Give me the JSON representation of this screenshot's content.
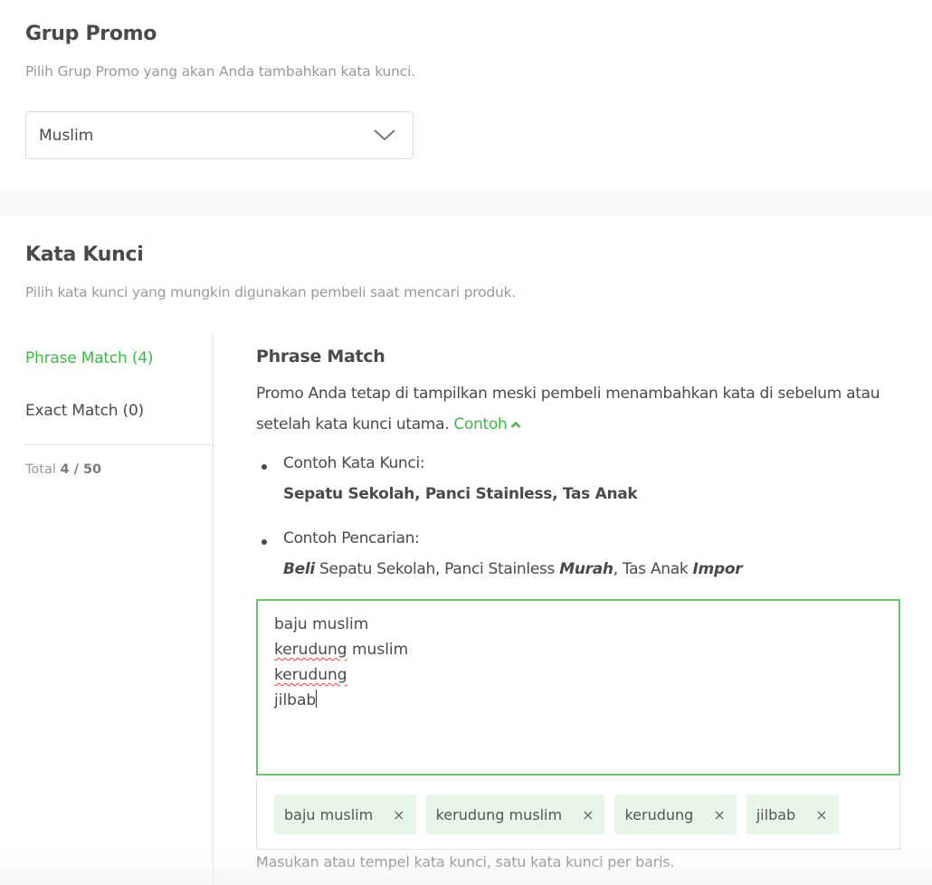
{
  "grup_promo": {
    "title": "Grup Promo",
    "subtitle": "Pilih Grup Promo yang akan Anda tambahkan kata kunci.",
    "select_value": "Muslim",
    "select_icon": "chevron-down-icon"
  },
  "kata_kunci": {
    "title": "Kata Kunci",
    "subtitle": "Pilih kata kunci yang mungkin digunakan pembeli saat mencari produk."
  },
  "sidebar": {
    "items": [
      {
        "label": "Phrase Match (4)",
        "active": true
      },
      {
        "label": "Exact Match (0)",
        "active": false
      }
    ],
    "total_label": "Total",
    "total_value": "4 / 50"
  },
  "phrase_match": {
    "title": "Phrase Match",
    "description": "Promo Anda tetap di tampilkan meski pembeli menambahkan kata di sebelum atau setelah kata kunci utama.",
    "example_link": "Contoh",
    "example_link_icon": "chevron-up-icon",
    "examples": [
      {
        "label": "Contoh Kata Kunci:",
        "parts": [
          {
            "text": "Sepatu Sekolah, Panci Stainless, Tas Anak",
            "style": "bold"
          }
        ]
      },
      {
        "label": "Contoh Pencarian:",
        "parts": [
          {
            "text": "Beli",
            "style": "bold-italic"
          },
          {
            "text": " Sepatu Sekolah, Panci Stainless ",
            "style": "normal"
          },
          {
            "text": "Murah",
            "style": "bold-italic"
          },
          {
            "text": ", Tas Anak ",
            "style": "normal"
          },
          {
            "text": "Impor",
            "style": "bold-italic"
          }
        ]
      }
    ],
    "textarea_lines": [
      "baju muslim",
      "kerudung muslim",
      "kerudung",
      "jilbab"
    ],
    "chips": [
      "baju muslim",
      "kerudung muslim",
      "kerudung",
      "jilbab"
    ],
    "chip_remove_glyph": "×",
    "hint": "Masukan atau tempel kata kunci, satu kata kunci per baris."
  },
  "colors": {
    "accent": "#42b549",
    "input_focus_border": "#6cc470",
    "chip_bg": "#e8f5e9",
    "band_bg": "#f8f8f9"
  }
}
